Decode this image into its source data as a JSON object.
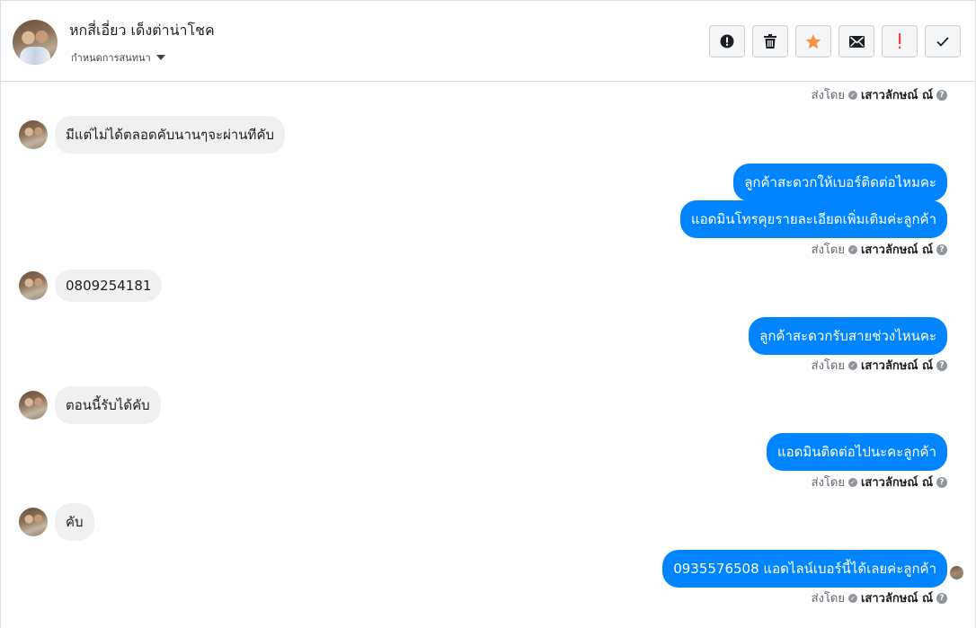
{
  "header": {
    "contact_name": "หกสี่เอี่ยว เด็งต่าน่าโชค",
    "thread_setting_label": "กำหนดการสนทนา",
    "toolbar": [
      {
        "name": "report-button",
        "icon": "alert-circle-icon"
      },
      {
        "name": "delete-button",
        "icon": "trash-icon"
      },
      {
        "name": "star-button",
        "icon": "star-icon",
        "color": "#f7923b"
      },
      {
        "name": "mark-unread-button",
        "icon": "envelope-icon"
      },
      {
        "name": "mark-important-button",
        "icon": "exclamation-icon",
        "color": "#fa3e3e"
      },
      {
        "name": "mark-done-button",
        "icon": "check-icon"
      }
    ]
  },
  "sent_by": {
    "prefix": "ส่งโดย",
    "agent": "เสาวลักษณ์ ณ์"
  },
  "messages": {
    "in_1": "มีแต่ไม่ได้ตลอดคับนานๆจะผ่านทีคับ",
    "out_1": "ลูกค้าสะดวกให้เบอร์ติดต่อไหมคะ",
    "out_2": "แอดมินโทรคุยรายละเอียดเพิ่มเติมค่ะลูกค้า",
    "in_2": "0809254181",
    "out_3": "ลูกค้าสะดวกรับสายช่วงไหนคะ",
    "in_3": "ตอนนี้รับได้คับ",
    "out_4": "แอดมินติดต่อไปนะคะลูกค้า",
    "in_4": "คับ",
    "out_5": "0935576508 แอดไลน์เบอร์นี้ได้เลยค่ะลูกค้า"
  },
  "colors": {
    "outgoing_bubble": "#0084ff",
    "incoming_bubble": "#f1f0f0"
  }
}
